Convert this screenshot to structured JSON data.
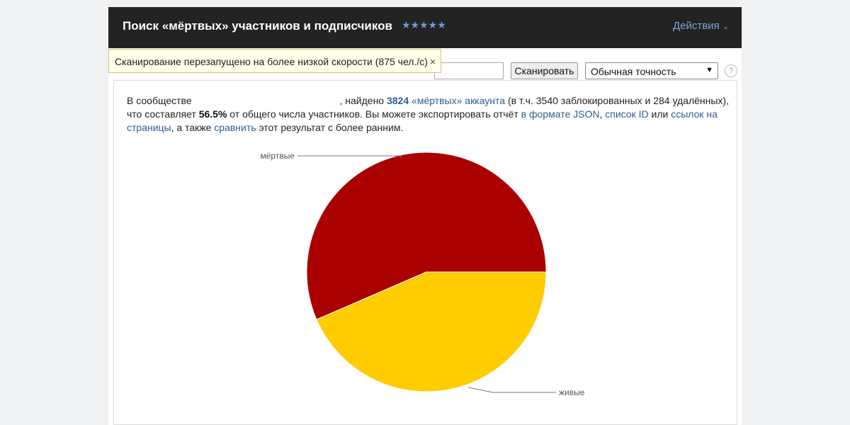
{
  "header": {
    "title": "Поиск «мёртвых» участников и подписчиков",
    "rating_stars": "★★★★★",
    "actions_label": "Действия"
  },
  "toolbar": {
    "input_value": "",
    "scan_button": "Сканировать",
    "precision_selected": "Обычная точность",
    "help_label": "?"
  },
  "toast": {
    "message": "Сканирование перезапущено на более низкой скорости (875 чел./с)",
    "close": "×"
  },
  "summary": {
    "p1": "В сообществе",
    "p2": ", найдено",
    "dead_count": "3824",
    "dead_link": "«мёртвых» аккаунта",
    "p3": "(в т.ч. 3540 заблокированных и 284 удалённых), что составляет",
    "percent": "56.5%",
    "p4": "от общего числа участников. Вы можете экспортировать отчёт",
    "json_link": "в формате JSON",
    "p5": ",",
    "ids_link": "список ID",
    "p6": "или",
    "links_link": "ссылок на страницы",
    "p7": ", а также",
    "compare_link": "сравнить",
    "p8": "этот результат с более ранним."
  },
  "chart_data": {
    "type": "pie",
    "slices": [
      {
        "label": "мёртвые",
        "value": 56.5,
        "color": "#aa0000"
      },
      {
        "label": "живые",
        "value": 43.5,
        "color": "#ffcc00"
      }
    ]
  }
}
